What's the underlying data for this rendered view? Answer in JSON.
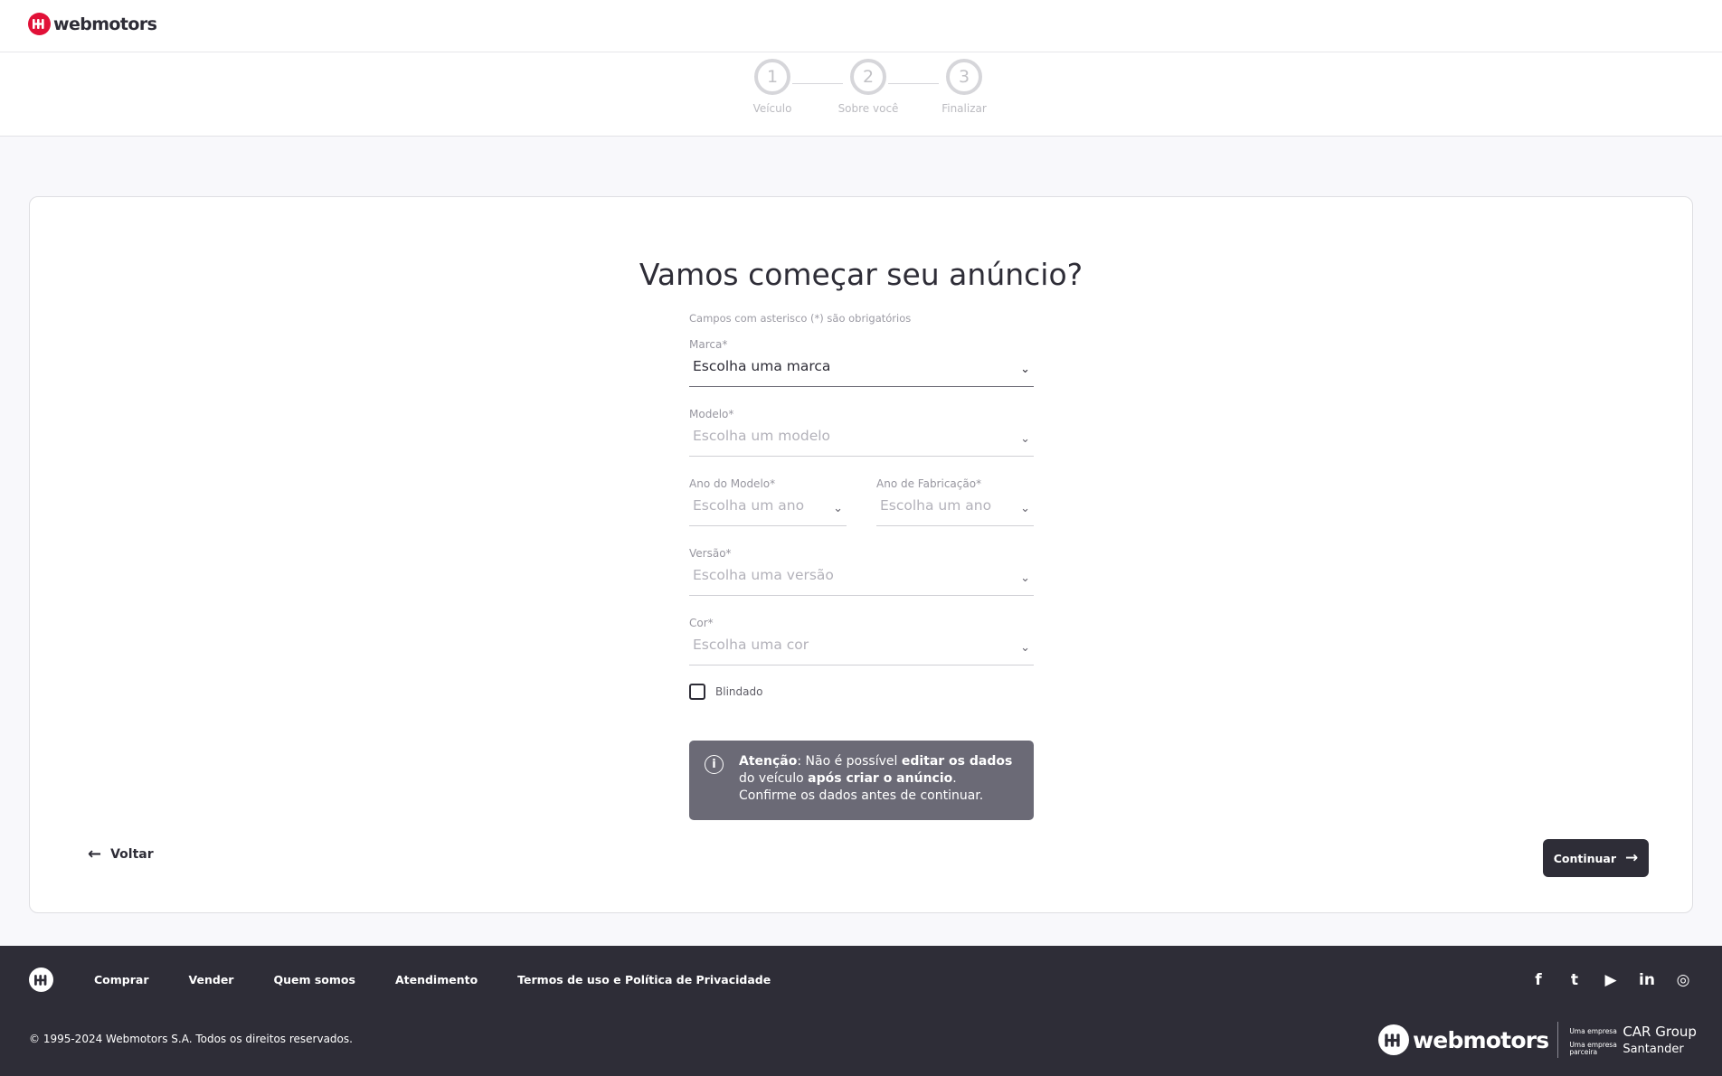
{
  "header": {
    "logo_text": "webmotors"
  },
  "steps": [
    {
      "number": "1",
      "label": "Veículo"
    },
    {
      "number": "2",
      "label": "Sobre você"
    },
    {
      "number": "3",
      "label": "Finalizar"
    }
  ],
  "form": {
    "title": "Vamos começar seu anúncio?",
    "required_note": "Campos com asterisco (*) são obrigatórios",
    "brand": {
      "label": "Marca*",
      "value": "Escolha uma marca"
    },
    "model": {
      "label": "Modelo*",
      "placeholder": "Escolha um modelo"
    },
    "model_year": {
      "label": "Ano do Modelo*",
      "placeholder": "Escolha um ano"
    },
    "manufacture_year": {
      "label": "Ano de Fabricação*",
      "placeholder": "Escolha um ano"
    },
    "version": {
      "label": "Versão*",
      "placeholder": "Escolha uma versão"
    },
    "color": {
      "label": "Cor*",
      "placeholder": "Escolha uma cor"
    },
    "armored": {
      "label": "Blindado",
      "checked": false
    },
    "alert": {
      "part1": "Atenção",
      "part2": ": Não é possível ",
      "part3": "editar os dados",
      "part4": " do veículo ",
      "part5": "após criar o anúncio",
      "part6": ". Confirme os dados antes de continuar."
    }
  },
  "actions": {
    "back": "Voltar",
    "continue": "Continuar"
  },
  "footer": {
    "links": [
      "Comprar",
      "Vender",
      "Quem somos",
      "Atendimento",
      "Termos de uso e Política de Privacidade"
    ],
    "social": [
      "f",
      "t",
      "▶",
      "in",
      "◎"
    ],
    "copyright": "© 1995-2024 Webmotors S.A. Todos os direitos reservados.",
    "brand_text": "webmotors",
    "company_label": "Uma empresa",
    "company_name": "CAR Group",
    "partner_label": "Uma empresa parceira",
    "partner_name": "Santander"
  },
  "colors": {
    "brand_red": "#e11138",
    "dark": "#2e2d37",
    "alert_bg": "#6b6a76"
  }
}
